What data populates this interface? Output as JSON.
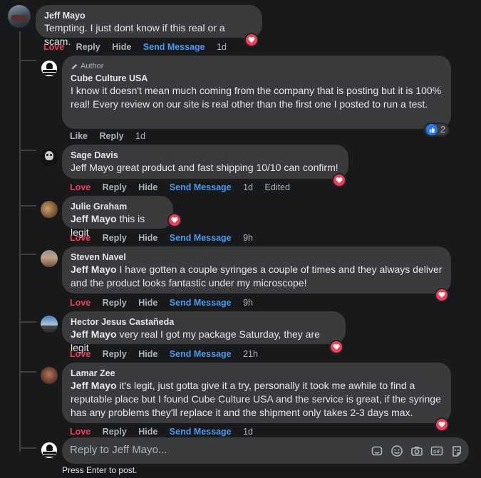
{
  "colors": {
    "background": "#18191a",
    "bubble": "#3a3b3c",
    "love": "#f33e58",
    "send_message": "#4a9af5",
    "muted": "#b0b3b8"
  },
  "top_comment": {
    "name": "Jeff Mayo",
    "text": "Tempting. I just dont know if this real or a scam.",
    "actions": {
      "love": "Love",
      "reply": "Reply",
      "hide": "Hide",
      "send": "Send Message",
      "time": "1d"
    }
  },
  "author_reply": {
    "badge": "Author",
    "name": "Cube Culture USA",
    "text": "I know it doesn't mean much coming from the company that is posting but it is 100% real! Every review on our site is real other than the first one I posted to run a test.",
    "like_count": "2",
    "actions": {
      "like": "Like",
      "reply": "Reply",
      "time": "1d"
    }
  },
  "replies": [
    {
      "name": "Sage Davis",
      "mention": "",
      "text": "Jeff Mayo great product and fast shipping 10/10 can confirm!",
      "time": "1d",
      "edited": "Edited"
    },
    {
      "name": "Julie Graham",
      "mention": "Jeff Mayo",
      "text": " this is legit",
      "time": "9h"
    },
    {
      "name": "Steven Navel",
      "mention": "Jeff Mayo",
      "text": " I have gotten a couple syringes a couple of times and they always deliver and the product looks fantastic under my microscope!",
      "time": "9h"
    },
    {
      "name": "Hector Jesus Castañeda",
      "mention": "Jeff Mayo",
      "text": " very real I got my package Saturday, they are legit",
      "time": "21h"
    },
    {
      "name": "Lamar Zee",
      "mention": "Jeff Mayo",
      "text": " it's legit, just gotta give it a try, personally it took me awhile to find a reputable place but I found Cube Culture USA and the service is great, if the syringe has any problems they'll replace it and the shipment only takes 2-3 days max.",
      "time": "1d"
    }
  ],
  "reply_actions": {
    "love": "Love",
    "reply": "Reply",
    "hide": "Hide",
    "send": "Send Message"
  },
  "reply_box": {
    "placeholder": "Reply to Jeff Mayo...",
    "hint": "Press Enter to post."
  },
  "icons": [
    "sticker-icon",
    "emoji-icon",
    "camera-icon",
    "gif-icon",
    "avatar-sticker-icon",
    "heart-icon",
    "like-icon",
    "pencil-icon"
  ]
}
